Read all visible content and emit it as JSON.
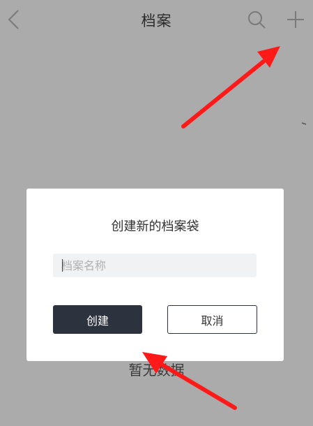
{
  "nav": {
    "title": "档案",
    "back_icon": "chevron-left-icon",
    "search_icon": "search-icon",
    "add_icon": "plus-icon"
  },
  "empty_state": {
    "text": "暂无数据"
  },
  "dialog": {
    "title": "创建新的档案袋",
    "input_placeholder": "档案名称",
    "input_value": "",
    "create_label": "创建",
    "cancel_label": "取消"
  },
  "colors": {
    "overlay": "#ababab",
    "primary_button": "#2d333e",
    "annotation_arrow": "#ff1a1a"
  }
}
